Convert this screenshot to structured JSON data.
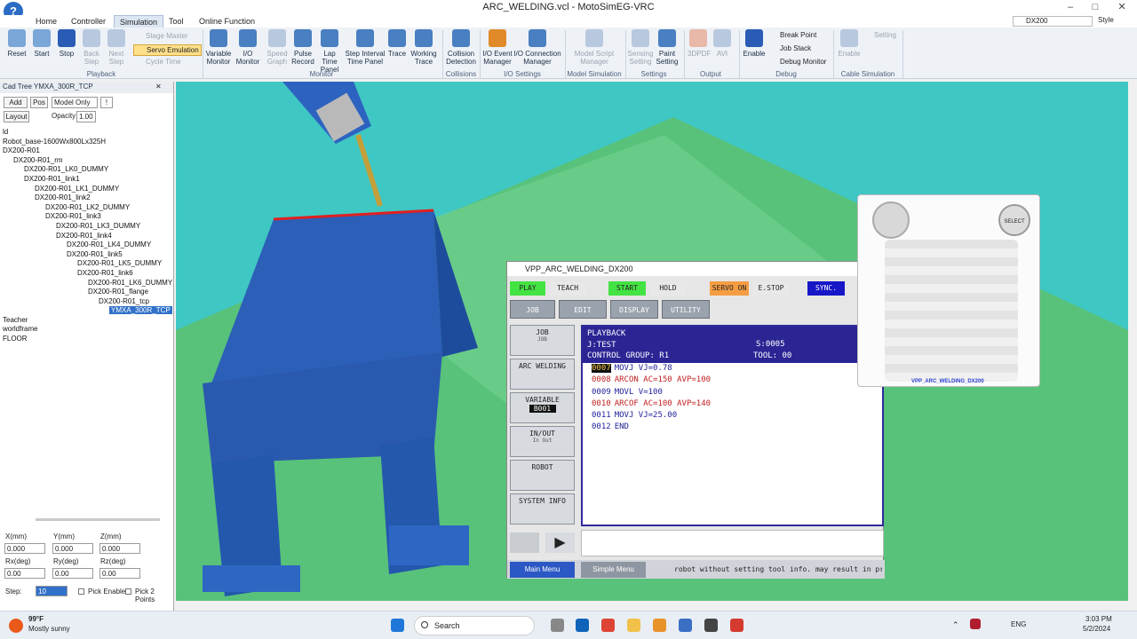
{
  "window": {
    "title": "ARC_WELDING.vcl - MotoSimEG-VRC",
    "logo": "?"
  },
  "tabs": [
    "Home",
    "Controller",
    "Simulation",
    "Tool",
    "Online Function"
  ],
  "tabs_active": "Simulation",
  "controller_select": "DX200",
  "style_label": "Style",
  "playback": {
    "reset": "Reset",
    "start": "Start",
    "stop": "Stop",
    "back_step": "Back Step",
    "next_step": "Next Step",
    "stage_master": "Stage Master",
    "servo_emulation": "Servo Emulation",
    "cycle_time": "Cycle Time",
    "group": "Playback"
  },
  "monitor": {
    "variable_monitor": "Variable Monitor",
    "io_monitor": "I/O Monitor",
    "speed_graph": "Speed Graph",
    "pulse_record": "Pulse Record",
    "lap_time_panel": "Lap Time Panel",
    "step_interval": "Step Interval Time Panel",
    "trace": "Trace",
    "working_trace": "Working Trace",
    "group": "Monitor"
  },
  "collisions": {
    "collision_detection": "Collision Detection",
    "group": "Collisions"
  },
  "io_settings": {
    "io_event": "I/O Event Manager",
    "io_connection": "I/O Connection Manager",
    "group": "I/O Settings"
  },
  "model_sim": {
    "model_script": "Model Script Manager",
    "group": "Model Simulation"
  },
  "settings": {
    "sensing": "Sensing Setting",
    "paint": "Paint Setting",
    "group": "Settings"
  },
  "output": {
    "pdf3d": "3DPDF",
    "avi": "AVI",
    "group": "Output"
  },
  "debug": {
    "enable": "Enable",
    "break_point": "Break Point",
    "job_stack": "Job Stack",
    "debug_monitor": "Debug Monitor",
    "group": "Debug"
  },
  "cable": {
    "enable": "Enable",
    "setting": "Setting",
    "group": "Cable Simulation"
  },
  "cadtree": {
    "title": "Cad Tree YMXA_300R_TCP",
    "add": "Add",
    "pos": "Pos",
    "mode": "Model Only",
    "excl": "!",
    "layout": "Layout",
    "opacity_label": "Opacity:",
    "opacity": "1.00",
    "items": [
      {
        "t": "ld",
        "d": 0
      },
      {
        "t": "Robot_base-1600Wx800Lx325H",
        "d": 0
      },
      {
        "t": "DX200-R01",
        "d": 0
      },
      {
        "t": "DX200-R01_rm",
        "d": 1
      },
      {
        "t": "DX200-R01_LK0_DUMMY",
        "d": 2
      },
      {
        "t": "DX200-R01_link1",
        "d": 2
      },
      {
        "t": "DX200-R01_LK1_DUMMY",
        "d": 3
      },
      {
        "t": "DX200-R01_link2",
        "d": 3
      },
      {
        "t": "DX200-R01_LK2_DUMMY",
        "d": 4
      },
      {
        "t": "DX200-R01_link3",
        "d": 4
      },
      {
        "t": "DX200-R01_LK3_DUMMY",
        "d": 5
      },
      {
        "t": "DX200-R01_link4",
        "d": 5
      },
      {
        "t": "DX200-R01_LK4_DUMMY",
        "d": 6
      },
      {
        "t": "DX200-R01_link5",
        "d": 6
      },
      {
        "t": "DX200-R01_LK5_DUMMY",
        "d": 7
      },
      {
        "t": "DX200-R01_link6",
        "d": 7
      },
      {
        "t": "DX200-R01_LK6_DUMMY",
        "d": 8
      },
      {
        "t": "DX200-R01_flange",
        "d": 8
      },
      {
        "t": "DX200-R01_tcp",
        "d": 9
      },
      {
        "t": "YMXA_300R_TCP",
        "d": 10,
        "sel": true
      },
      {
        "t": "Teacher",
        "d": 0
      },
      {
        "t": "worldframe",
        "d": 0
      },
      {
        "t": "FLOOR",
        "d": 0
      }
    ]
  },
  "coords": {
    "x_label": "X(mm)",
    "y_label": "Y(mm)",
    "z_label": "Z(mm)",
    "rx_label": "Rx(deg)",
    "ry_label": "Ry(deg)",
    "rz_label": "Rz(deg)",
    "x": "0.000",
    "y": "0.000",
    "z": "0.000",
    "rx": "0.00",
    "ry": "0.00",
    "rz": "0.00",
    "step_label": "Step:",
    "step": "10",
    "pick_enable": "Pick Enable",
    "pick_2points": "Pick 2 Points"
  },
  "teach_pendant": {
    "title": "VPP_ARC_WELDING_DX200",
    "play": "PLAY",
    "teach": "TEACH",
    "start": "START",
    "hold": "HOLD",
    "servo_on": "SERVO ON",
    "estop": "E.STOP",
    "sync": "SYNC.",
    "menus": [
      "JOB",
      "EDIT",
      "DISPLAY",
      "UTILITY"
    ],
    "side": [
      {
        "label": "JOB",
        "sub": "JOB"
      },
      {
        "label": "ARC WELDING",
        "sub": ""
      },
      {
        "label": "VARIABLE",
        "sub": "B001"
      },
      {
        "label": "IN/OUT",
        "sub": "In Out"
      },
      {
        "label": "ROBOT",
        "sub": ""
      },
      {
        "label": "SYSTEM INFO",
        "sub": ""
      }
    ],
    "screen": {
      "mode": "PLAYBACK",
      "job": "J:TEST",
      "step": "S:0005",
      "group": "CONTROL GROUP: R1",
      "tool": "TOOL: 00"
    },
    "lines": [
      {
        "num": "0007",
        "cmd": "MOVJ VJ=0.78",
        "cur": true,
        "color": "#1f1f9b"
      },
      {
        "num": "0008",
        "cmd": "ARCON AC=150 AVP=100",
        "color": "#c02020"
      },
      {
        "num": "0009",
        "cmd": "MOVL V=100",
        "color": "#1f1f9b"
      },
      {
        "num": "0010",
        "cmd": "ARCOF AC=100 AVP=140",
        "color": "#c02020"
      },
      {
        "num": "0011",
        "cmd": "MOVJ VJ=25.00",
        "color": "#1f1f9b"
      },
      {
        "num": "0012",
        "cmd": "END",
        "color": "#1f1f9b"
      }
    ],
    "main_menu": "Main Menu",
    "simple_menu": "Simple Menu",
    "message": "robot without setting tool info. may result in pre"
  },
  "pendant_label": "VPP_ARC_WELDING_DX200",
  "pendant_select": "SELECT",
  "taskbar": {
    "temp": "99°F",
    "weather": "Mostly sunny",
    "search": "Search",
    "lang": "ENG",
    "time": "3:03 PM",
    "date": "5/2/2024"
  }
}
